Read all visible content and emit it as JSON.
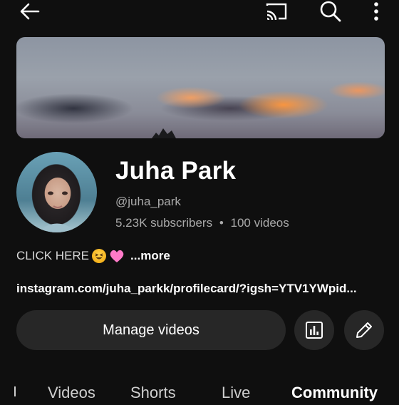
{
  "topbar": {
    "icons": [
      "back-arrow-icon",
      "cast-icon",
      "search-icon",
      "more-vert-icon"
    ]
  },
  "channel": {
    "name": "Juha Park",
    "handle": "@juha_park",
    "subscribers": "5.23K subscribers",
    "separator": "•",
    "videos": "100 videos",
    "description": "CLICK HERE",
    "more_label": "...more",
    "link": "instagram.com/juha_parkk/profilecard/?igsh=YTV1YWpid..."
  },
  "actions": {
    "manage_label": "Manage videos",
    "analytics_icon": "analytics-icon",
    "edit_icon": "edit-pencil-icon"
  },
  "tabs": [
    {
      "label": "Videos"
    },
    {
      "label": "Shorts"
    },
    {
      "label": "Live"
    },
    {
      "label": "Community"
    }
  ]
}
